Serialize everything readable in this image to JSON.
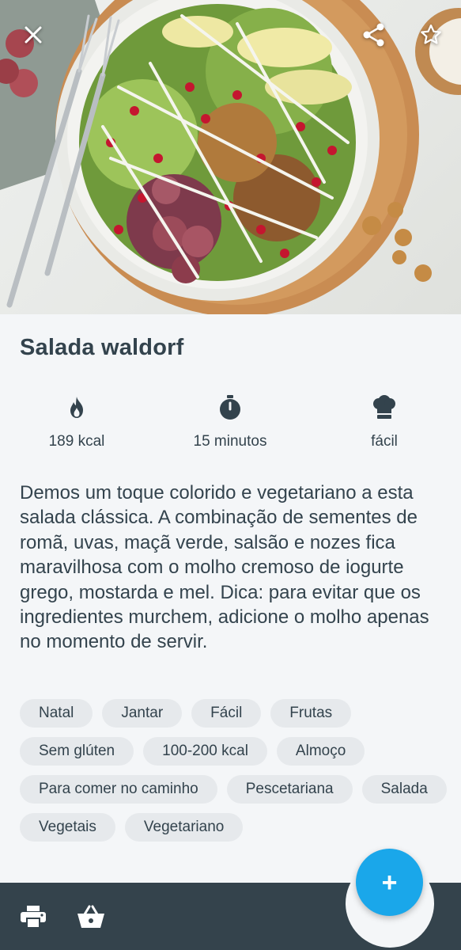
{
  "recipe": {
    "title": "Salada waldorf",
    "description": "Demos um toque colorido e vegetariano a esta salada clássica. A combinação de sementes de romã, uvas, maçã verde, salsão e nozes fica maravilhosa com o molho cremoso de iogurte grego, mostarda e mel. Dica: para evitar que os ingredientes murchem, adicione o molho apenas no momento de servir."
  },
  "hero": {
    "image_alt": "Salada waldorf",
    "icons": {
      "close": "close-icon",
      "share": "share-icon",
      "favorite": "star-outline-icon"
    }
  },
  "stats": {
    "calories": {
      "label": "189 kcal",
      "icon": "flame-icon"
    },
    "time": {
      "label": "15 minutos",
      "icon": "stopwatch-icon"
    },
    "difficulty": {
      "label": "fácil",
      "icon": "chef-hat-icon"
    }
  },
  "tags": [
    "Natal",
    "Jantar",
    "Fácil",
    "Frutas",
    "Sem glúten",
    "100-200 kcal",
    "Almoço",
    "Para comer no caminho",
    "Pescetariana",
    "Salada",
    "Vegetais",
    "Vegetariano"
  ],
  "bottom_bar": {
    "icons": {
      "print": "printer-icon",
      "basket": "basket-icon",
      "add": "plus-icon"
    },
    "add_symbol": "+"
  },
  "colors": {
    "accent": "#1aa7ea",
    "bar": "#34434c",
    "text": "#33434d",
    "tag_bg": "#e6e9ec",
    "page_bg": "#f4f6f8"
  }
}
